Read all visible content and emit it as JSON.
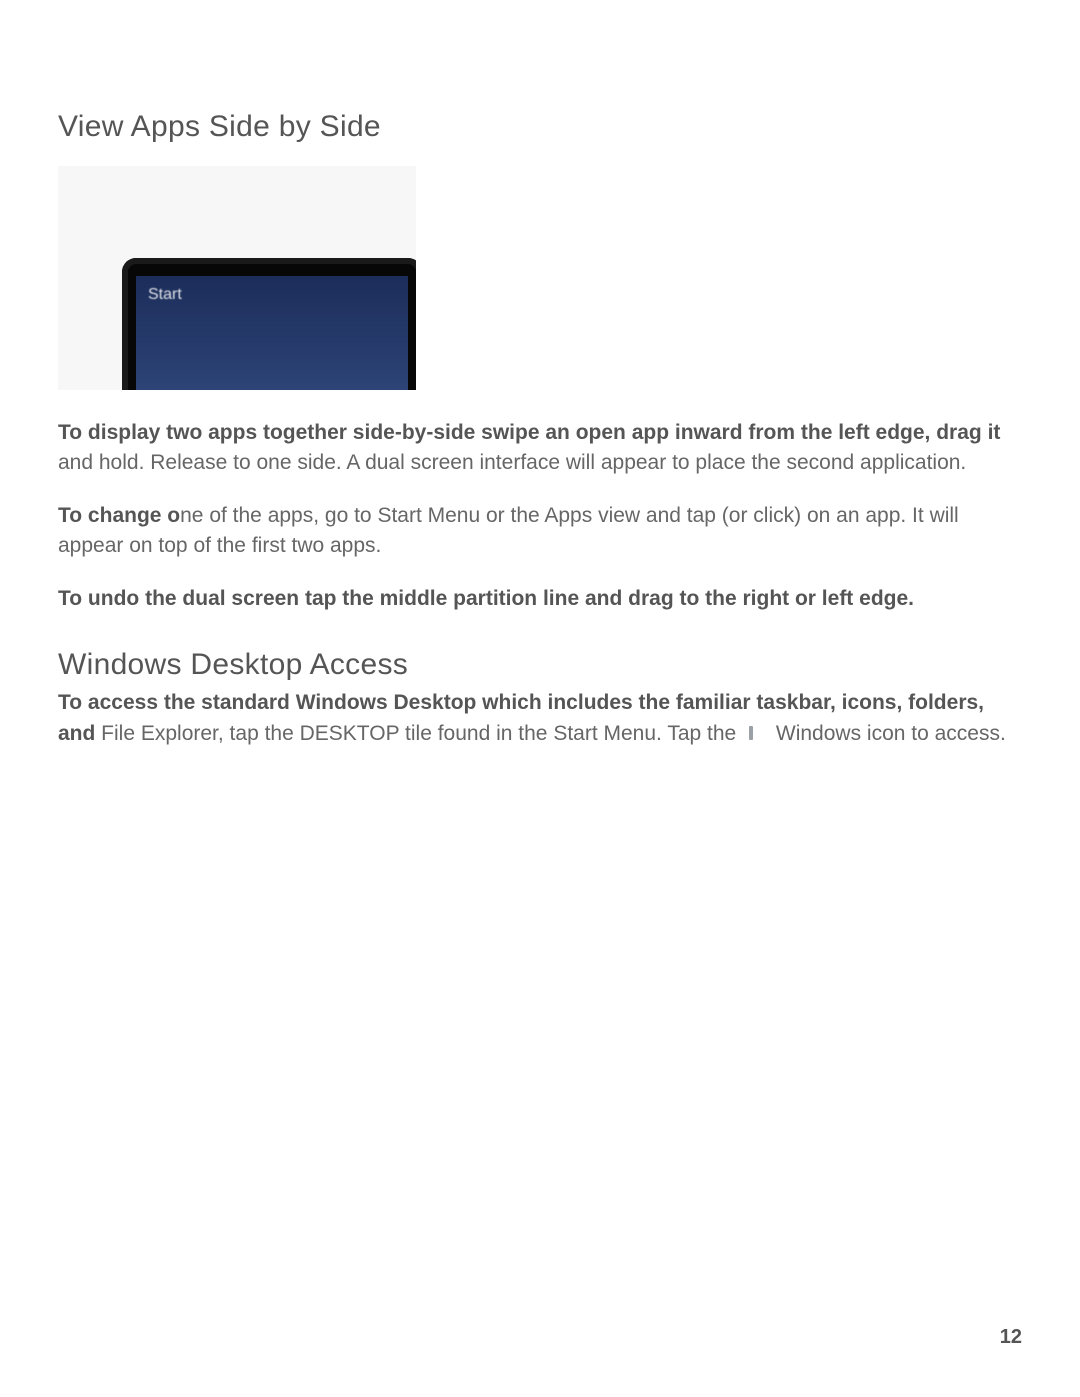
{
  "section1": {
    "heading": "View Apps Side by Side",
    "image": {
      "screen_label": "Start"
    },
    "p1_bold_lead": "To display two apps together side-by-side swipe an open app inward from the left edge, drag it",
    "p1_tail": " and hold. Release to one side. A dual screen interface will appear to place the second application.",
    "p2_bold_lead": "To change o",
    "p2_tail": "ne of the apps, go to Start Menu or the Apps view and tap (or click) on an app. It will appear on top of the first two apps.",
    "p3_bold_full": "To undo the dual screen tap the middle partition line and drag to the right or left edge."
  },
  "section2": {
    "heading": "Windows Desktop Access",
    "p1_bold_lead": "To access the standard Windows Desktop which includes the familiar taskbar, icons, folders, and",
    "p1_tail_a": " File Explorer, tap the DESKTOP tile found in the Start Menu. Tap the ",
    "p1_tail_b": " Windows icon to access."
  },
  "page_number": "12"
}
